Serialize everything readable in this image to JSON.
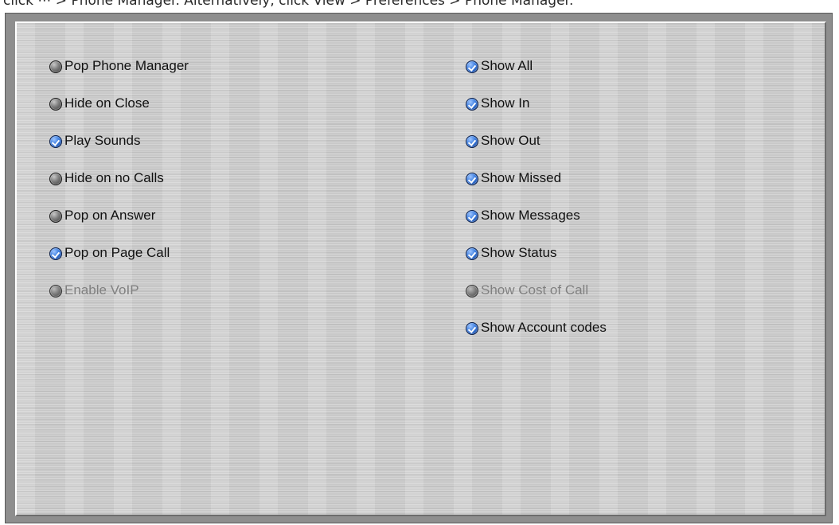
{
  "caption": "click ⋯ > Phone Manager. Alternatively, click View > Preferences > Phone Manager.",
  "left_options": [
    {
      "label": "Pop Phone Manager",
      "checked": false,
      "enabled": true
    },
    {
      "label": "Hide on Close",
      "checked": false,
      "enabled": true
    },
    {
      "label": "Play Sounds",
      "checked": true,
      "enabled": true
    },
    {
      "label": "Hide on no Calls",
      "checked": false,
      "enabled": true
    },
    {
      "label": "Pop on Answer",
      "checked": false,
      "enabled": true
    },
    {
      "label": "Pop on Page Call",
      "checked": true,
      "enabled": true
    },
    {
      "label": "Enable VoIP",
      "checked": false,
      "enabled": false
    }
  ],
  "right_options": [
    {
      "label": "Show All",
      "checked": true,
      "enabled": true
    },
    {
      "label": "Show In",
      "checked": true,
      "enabled": true
    },
    {
      "label": "Show Out",
      "checked": true,
      "enabled": true
    },
    {
      "label": "Show Missed",
      "checked": true,
      "enabled": true
    },
    {
      "label": "Show Messages",
      "checked": true,
      "enabled": true
    },
    {
      "label": "Show Status",
      "checked": true,
      "enabled": true
    },
    {
      "label": "Show Cost of Call",
      "checked": false,
      "enabled": false
    },
    {
      "label": "Show Account codes",
      "checked": true,
      "enabled": true
    }
  ],
  "colors": {
    "panel": "#cfcfcf",
    "frame": "#8e8e8e",
    "checked": "#3b7de0",
    "unchecked": "#6e6e6e",
    "disabled_text": "#808080"
  },
  "icons": {
    "checked": "blue-checkmark-radio-icon",
    "unchecked": "gray-radio-icon"
  }
}
